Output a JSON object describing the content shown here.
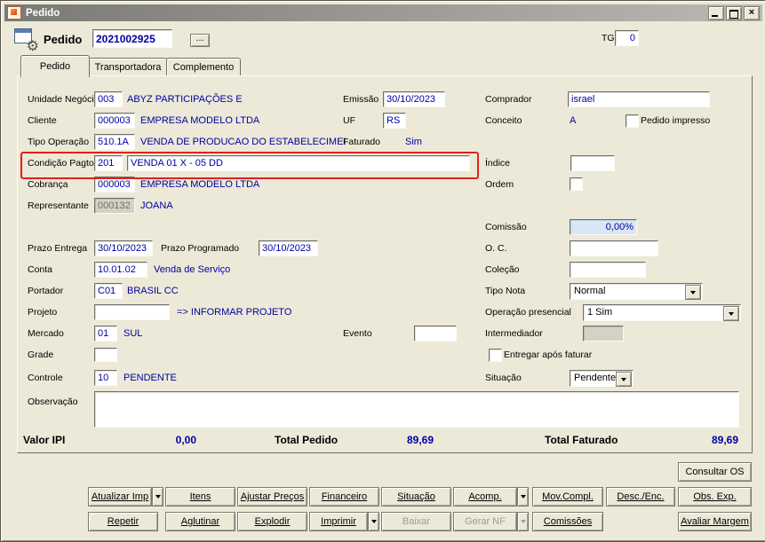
{
  "window": {
    "title": "Pedido"
  },
  "header": {
    "title": "Pedido",
    "order_number": "2021002925",
    "browse_button": "...",
    "tg_label": "TG",
    "tg_value": "0"
  },
  "tabs": {
    "pedido": "Pedido",
    "transportadora": "Transportadora",
    "complemento": "Complemento"
  },
  "form": {
    "unidade_negocio": {
      "label": "Unidade Negócio",
      "code": "003",
      "desc": "ABYZ PARTICIPAÇÕES E"
    },
    "cliente": {
      "label": "Cliente",
      "code": "000003",
      "desc": "EMPRESA MODELO LTDA"
    },
    "tipo_operacao": {
      "label": "Tipo Operação",
      "code": "510.1A",
      "desc": "VENDA DE PRODUCAO DO ESTABELECIMEI"
    },
    "condicao_pagto": {
      "label": "Condição Pagto.",
      "code": "201",
      "desc": "VENDA 01 X - 05 DD"
    },
    "cobranca": {
      "label": "Cobrança",
      "code": "000003",
      "desc": "EMPRESA MODELO LTDA"
    },
    "representante": {
      "label": "Representante",
      "code": "000132",
      "desc": "JOANA"
    },
    "emissao": {
      "label": "Emissão",
      "value": "30/10/2023"
    },
    "uf": {
      "label": "UF",
      "value": "RS"
    },
    "faturado": {
      "label": "Faturado",
      "value": "Sim"
    },
    "comprador": {
      "label": "Comprador",
      "value": "israel"
    },
    "conceito": {
      "label": "Conceito",
      "value": "A"
    },
    "pedido_impresso": {
      "label": "Pedido impresso",
      "checked": false
    },
    "indice": {
      "label": "Índice",
      "value": ""
    },
    "ordem": {
      "label": "Ordem",
      "value": ""
    },
    "comissao": {
      "label": "Comissão",
      "value": "0,00%"
    },
    "prazo_entrega": {
      "label": "Prazo Entrega",
      "value": "30/10/2023"
    },
    "prazo_programado": {
      "label": "Prazo Programado",
      "value": "30/10/2023"
    },
    "oc": {
      "label": "O. C.",
      "value": ""
    },
    "conta": {
      "label": "Conta",
      "code": "10.01.02",
      "desc": "Venda de Serviço"
    },
    "colecao": {
      "label": "Coleção",
      "value": ""
    },
    "portador": {
      "label": "Portador",
      "code": "C01",
      "desc": "BRASIL CC"
    },
    "tipo_nota": {
      "label": "Tipo Nota",
      "value": "Normal"
    },
    "projeto": {
      "label": "Projeto",
      "code": "",
      "desc": "=> INFORMAR PROJETO"
    },
    "operacao_presencial": {
      "label": "Operação presencial",
      "value": "1 Sim"
    },
    "mercado": {
      "label": "Mercado",
      "code": "01",
      "desc": "SUL"
    },
    "evento": {
      "label": "Evento",
      "value": ""
    },
    "intermediador": {
      "label": "Intermediador",
      "value": ""
    },
    "grade": {
      "label": "Grade"
    },
    "entregar_apos_faturar": {
      "label": "Entregar após faturar",
      "checked": false
    },
    "controle": {
      "label": "Controle",
      "code": "10",
      "desc": "PENDENTE"
    },
    "situacao": {
      "label": "Situação",
      "value": "Pendente"
    },
    "observacao": {
      "label": "Observação",
      "value": ""
    }
  },
  "totals": {
    "valor_ipi_label": "Valor IPI",
    "valor_ipi_value": "0,00",
    "total_pedido_label": "Total Pedido",
    "total_pedido_value": "89,69",
    "total_faturado_label": "Total Faturado",
    "total_faturado_value": "89,69"
  },
  "actions": {
    "consultar_os": "Consultar OS",
    "atualizar_imp": "Atualizar Imp",
    "itens": "Itens",
    "ajustar_precos": "Ajustar Preços",
    "financeiro": "Financeiro",
    "situacao": "Situação",
    "acomp": "Acomp.",
    "mov_compl": "Mov.Compl.",
    "desc_enc": "Desc./Enc.",
    "obs_exp": "Obs. Exp.",
    "repetir": "Repetir",
    "aglutinar": "Aglutinar",
    "explodir": "Explodir",
    "imprimir": "Imprimir",
    "baixar": "Baixar",
    "gerar_nf": "Gerar NF",
    "comissoes": "Comissões",
    "avaliar_margem": "Avaliar Margem"
  },
  "icons": {
    "gear": "⚙",
    "close": "×"
  },
  "colors": {
    "value_text": "#0000a0",
    "highlight_box": "#e3201b",
    "comissao_bg": "#d9e6f5"
  }
}
